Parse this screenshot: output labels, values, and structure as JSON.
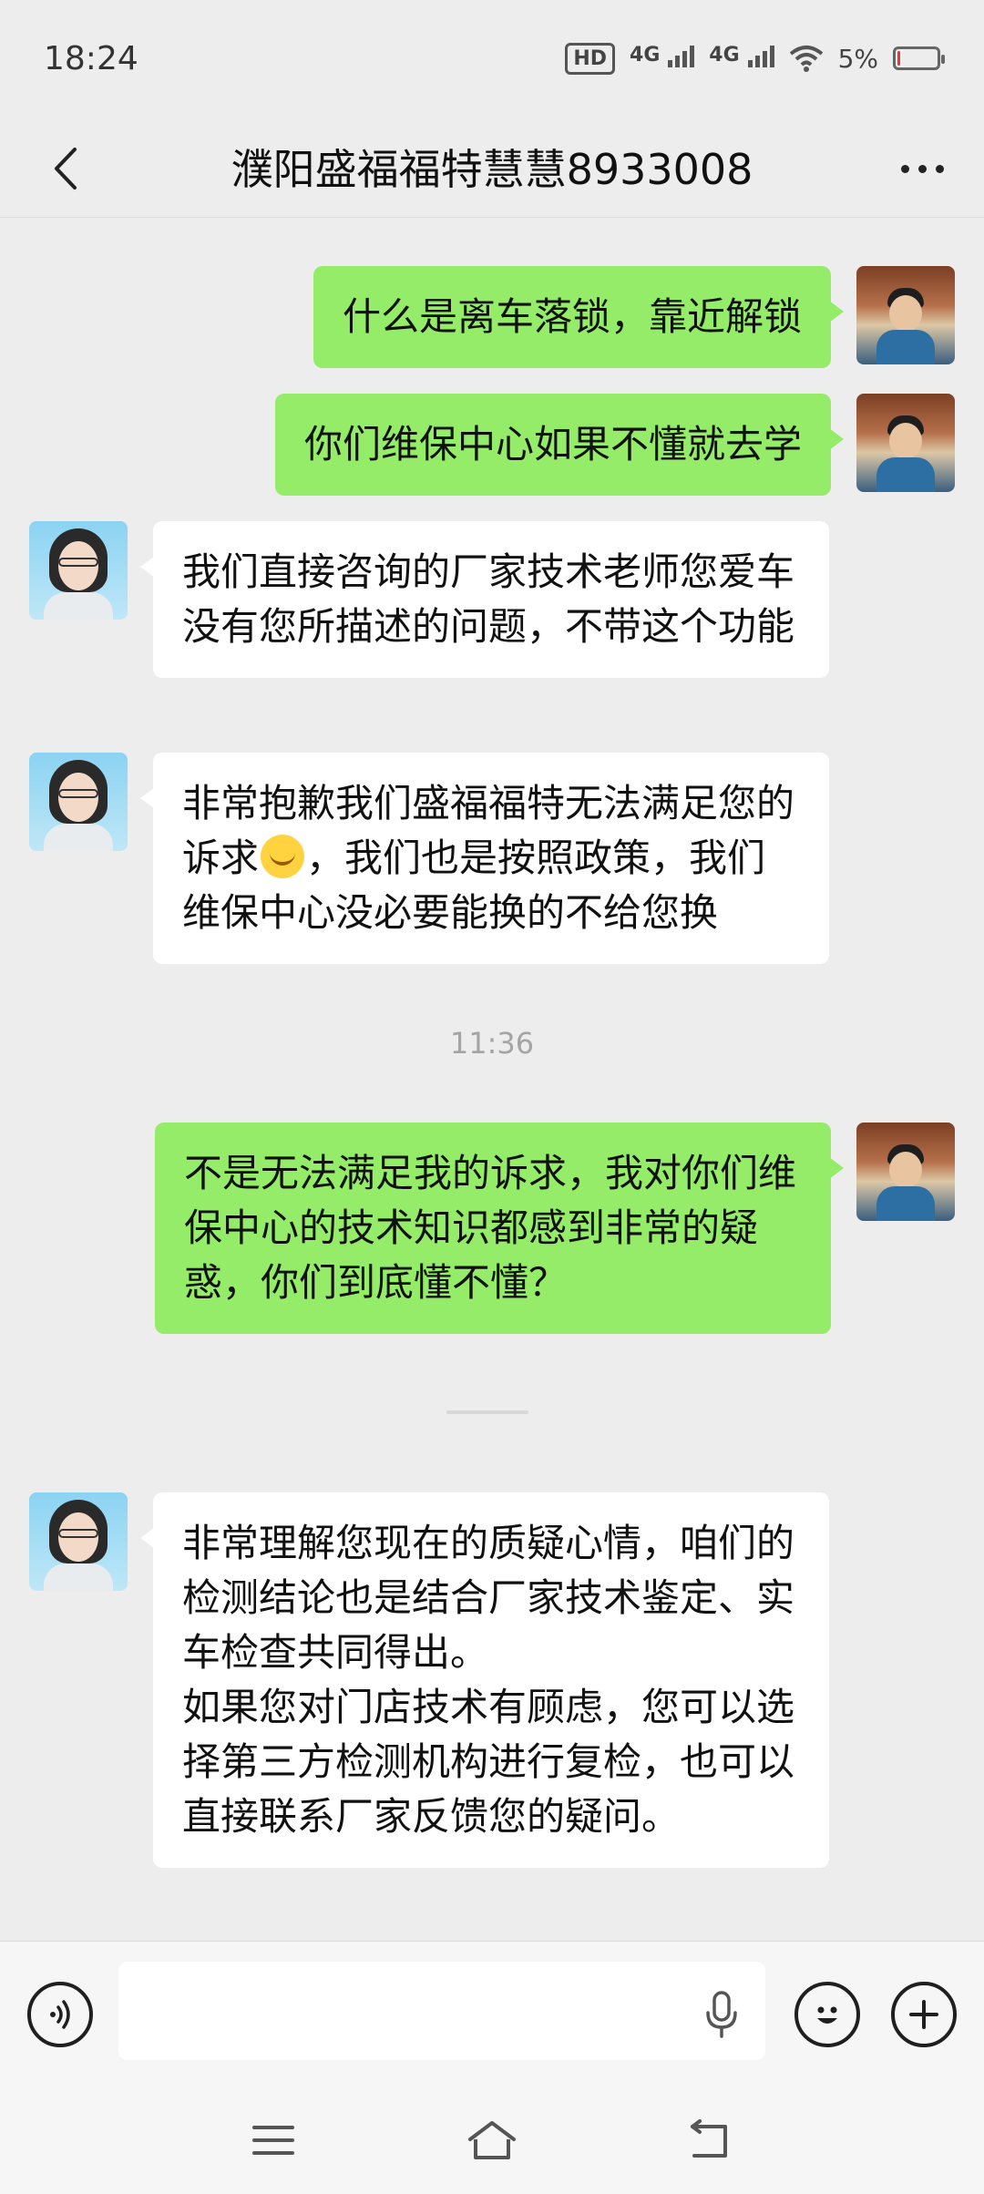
{
  "status_bar": {
    "time": "18:24",
    "hd_label": "HD",
    "net1": "4G",
    "net2": "4G",
    "battery": "5%",
    "battery_level": 0.05,
    "battery_color": "#e53935"
  },
  "header": {
    "title": "濮阳盛福福特慧慧8933008",
    "back_icon": "chevron-left-icon",
    "more_icon": "more-dots-icon"
  },
  "messages": [
    {
      "side": "right",
      "text": "什么是离车落锁，靠近解锁"
    },
    {
      "side": "right",
      "text": "你们维保中心如果不懂就去学"
    },
    {
      "side": "left",
      "text": "我们直接咨询的厂家技术老师您爱车没有您所描述的问题，不带这个功能"
    },
    {
      "side": "left",
      "text_before_emoji": "非常抱歉我们盛福福特无法满足您的诉求",
      "text_after_emoji": "，我们也是按照政策，我们维保中心没必要能换的不给您换"
    },
    {
      "side": "right",
      "text": "不是无法满足我的诉求，我对你们维保中心的技术知识都感到非常的疑惑，你们到底懂不懂？"
    },
    {
      "side": "left",
      "text": "非常理解您现在的质疑心情，咱们的检测结论也是结合厂家技术鉴定、实车检查共同得出。\n如果您对门店技术有顾虑，您可以选择第三方检测机构进行复检，也可以直接联系厂家反馈您的疑问。"
    }
  ],
  "timestamps": [
    "11:36"
  ],
  "colors": {
    "sent_bubble": "#95ec69",
    "received_bubble": "#ffffff",
    "background": "#ededed"
  },
  "input_bar": {
    "placeholder": ""
  }
}
